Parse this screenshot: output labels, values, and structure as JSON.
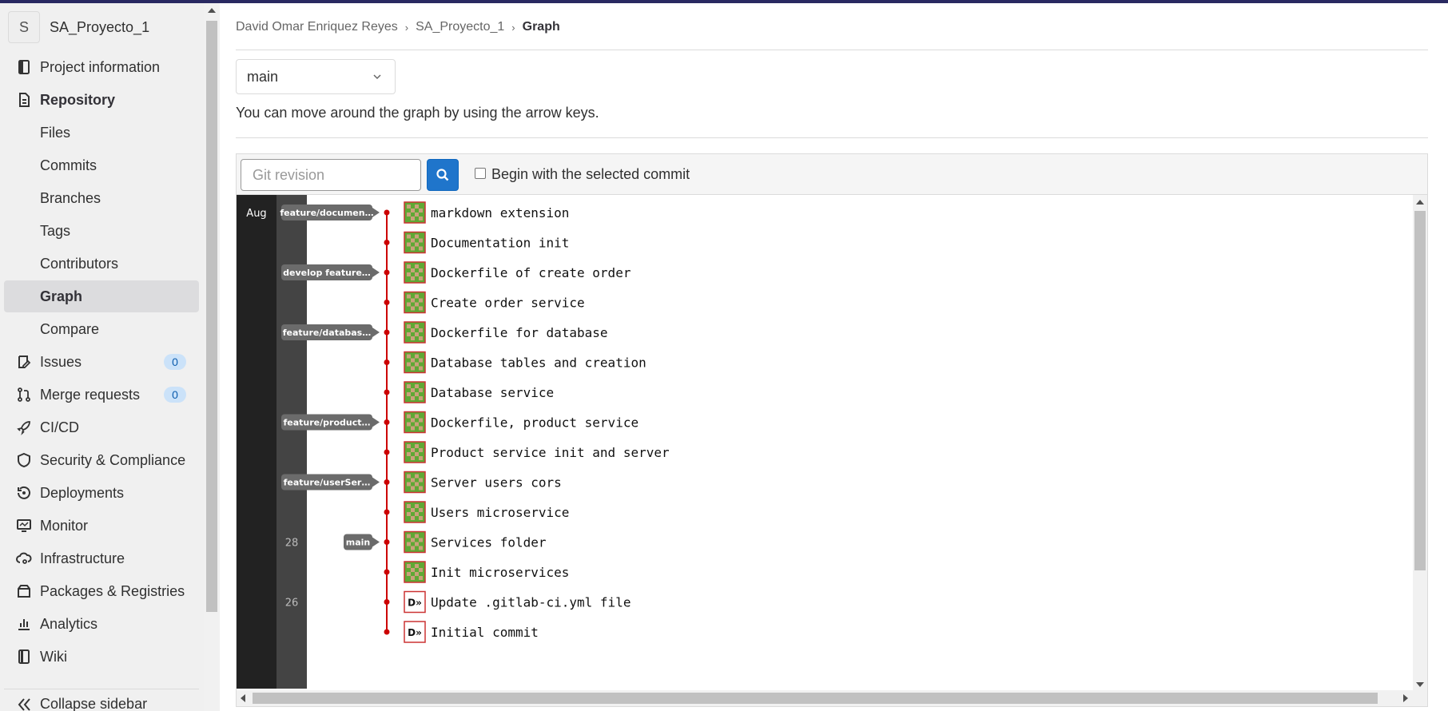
{
  "sidebar": {
    "project_initial": "S",
    "project_name": "SA_Proyecto_1",
    "items": [
      {
        "label": "Project information",
        "icon": "project-icon"
      },
      {
        "label": "Repository",
        "icon": "document-icon"
      },
      {
        "label": "Files"
      },
      {
        "label": "Commits"
      },
      {
        "label": "Branches"
      },
      {
        "label": "Tags"
      },
      {
        "label": "Contributors"
      },
      {
        "label": "Graph"
      },
      {
        "label": "Compare"
      },
      {
        "label": "Issues",
        "icon": "issues-icon",
        "badge": "0"
      },
      {
        "label": "Merge requests",
        "icon": "merge-request-icon",
        "badge": "0"
      },
      {
        "label": "CI/CD",
        "icon": "rocket-icon"
      },
      {
        "label": "Security & Compliance",
        "icon": "shield-icon"
      },
      {
        "label": "Deployments",
        "icon": "deployments-icon"
      },
      {
        "label": "Monitor",
        "icon": "monitor-icon"
      },
      {
        "label": "Infrastructure",
        "icon": "cloud-gear-icon"
      },
      {
        "label": "Packages & Registries",
        "icon": "package-icon"
      },
      {
        "label": "Analytics",
        "icon": "chart-icon"
      },
      {
        "label": "Wiki",
        "icon": "book-icon"
      }
    ],
    "collapse_label": "Collapse sidebar"
  },
  "breadcrumb": {
    "owner": "David Omar Enriquez Reyes",
    "project": "SA_Proyecto_1",
    "current": "Graph"
  },
  "branch_selector": {
    "value": "main"
  },
  "hint": "You can move around the graph by using the arrow keys.",
  "search": {
    "placeholder": "Git revision",
    "checkbox_label": "Begin with the selected commit"
  },
  "graph": {
    "month": "Aug",
    "line_color": "#cc0000",
    "commits": [
      {
        "message": "markdown extension",
        "ref": "feature/documen…",
        "day": "",
        "avatar": "green"
      },
      {
        "message": "Documentation init",
        "ref": "",
        "day": "",
        "avatar": "green"
      },
      {
        "message": "Dockerfile of create order",
        "ref": "develop feature…",
        "day": "",
        "avatar": "green"
      },
      {
        "message": "Create order service",
        "ref": "",
        "day": "",
        "avatar": "green"
      },
      {
        "message": "Dockerfile for database",
        "ref": "feature/databas…",
        "day": "",
        "avatar": "green"
      },
      {
        "message": "Database tables and creation",
        "ref": "",
        "day": "",
        "avatar": "green"
      },
      {
        "message": "Database service",
        "ref": "",
        "day": "",
        "avatar": "green"
      },
      {
        "message": "Dockerfile, product service",
        "ref": "feature/product…",
        "day": "",
        "avatar": "green"
      },
      {
        "message": "Product service init and server",
        "ref": "",
        "day": "",
        "avatar": "green"
      },
      {
        "message": "Server users cors",
        "ref": "feature/userSer…",
        "day": "",
        "avatar": "green"
      },
      {
        "message": "Users microservice",
        "ref": "",
        "day": "",
        "avatar": "green"
      },
      {
        "message": "Services folder",
        "ref": "main",
        "day": "28",
        "avatar": "green"
      },
      {
        "message": "Init microservices",
        "ref": "",
        "day": "",
        "avatar": "green"
      },
      {
        "message": "Update .gitlab-ci.yml file",
        "ref": "",
        "day": "26",
        "avatar": "logo"
      },
      {
        "message": "Initial commit",
        "ref": "",
        "day": "",
        "avatar": "logo"
      }
    ]
  }
}
